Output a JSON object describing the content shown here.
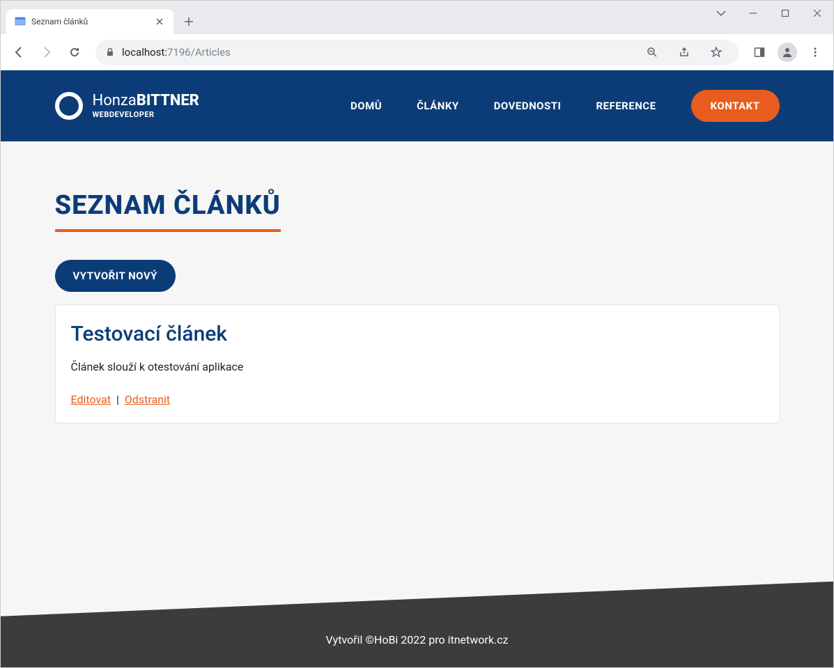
{
  "browser": {
    "tab_title": "Seznam článků",
    "url_host": "localhost:",
    "url_rest": "7196/Articles"
  },
  "header": {
    "logo_name_light": "Honza",
    "logo_name_bold": "BITTNER",
    "logo_subtitle": "WEBDEVELOPER",
    "nav": {
      "home": "DOMŮ",
      "articles": "ČLÁNKY",
      "skills": "DOVEDNOSTI",
      "references": "REFERENCE",
      "contact": "KONTAKT"
    }
  },
  "main": {
    "page_title": "SEZNAM ČLÁNKŮ",
    "create_button": "VYTVOŘIT NOVÝ",
    "articles": [
      {
        "title": "Testovací článek",
        "description": "Článek slouží k otestování aplikace",
        "edit_label": "Editovat",
        "delete_label": "Odstranit"
      }
    ],
    "action_separator": " | "
  },
  "footer": {
    "text": "Vytvořil ©HoBi 2022 pro itnetwork.cz"
  }
}
